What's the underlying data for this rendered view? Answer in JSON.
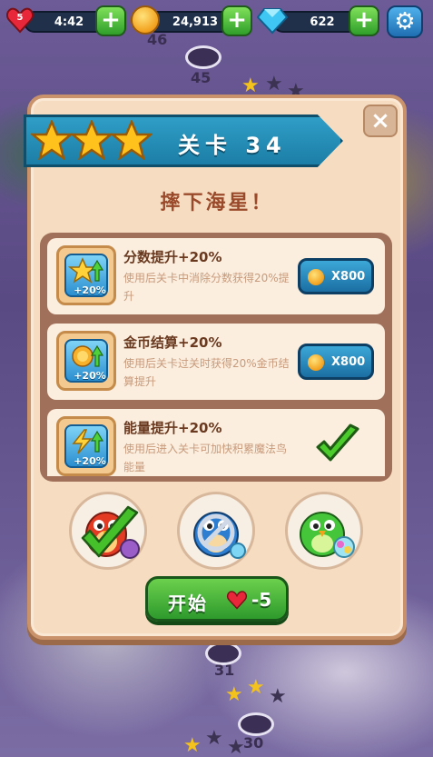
{
  "hud": {
    "lives_badge": "5",
    "timer": "4:42",
    "coins": "24,913",
    "gems": "622",
    "plus_symbol": "+"
  },
  "map": {
    "level_labels": [
      "46",
      "45",
      "31",
      "30"
    ]
  },
  "dialog": {
    "level_title": "关卡 34",
    "stars_earned": 3,
    "subtitle": "摔下海星！",
    "close_symbol": "×",
    "boosts": [
      {
        "title": "分数提升+20%",
        "desc": "使用后关卡中消除分数获得20%提升",
        "icon_pct": "+20%",
        "price": "X800",
        "state": "buy"
      },
      {
        "title": "金币结算+20%",
        "desc": "使用后关卡过关时获得20%金币结算提升",
        "icon_pct": "+20%",
        "price": "X800",
        "state": "buy"
      },
      {
        "title": "能量提升+20%",
        "desc": "使用后进入关卡可加快积累魔法鸟能量",
        "icon_pct": "+20%",
        "price": "",
        "state": "owned"
      }
    ],
    "start": {
      "label": "开始",
      "cost": "-5"
    }
  },
  "colors": {
    "ribbon": "#2f9ec7",
    "dialog_bg": "#f6dcc0",
    "start_green": "#3aa833",
    "price_blue": "#1f78b0",
    "title_brown": "#9a4a2a"
  }
}
